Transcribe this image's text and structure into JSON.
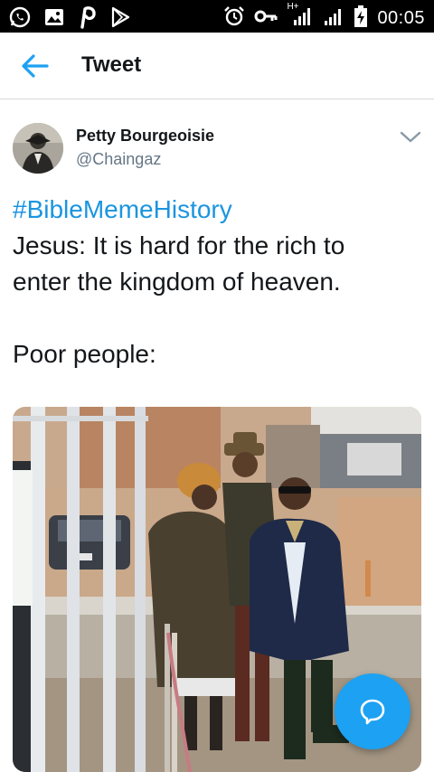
{
  "status_bar": {
    "time": "00:05",
    "network_label": "H+",
    "icons": [
      "whatsapp-icon",
      "gallery-icon",
      "pinterest-icon",
      "play-store-icon",
      "alarm-icon",
      "vpn-key-icon",
      "signal-icon",
      "signal-icon-2",
      "battery-charging-icon"
    ]
  },
  "app_bar": {
    "title": "Tweet",
    "back_icon": "arrow-left-icon"
  },
  "tweet": {
    "display_name": "Petty Bourgeoisie",
    "handle": "@Chaingaz",
    "hashtag": "#BibleMemeHistory",
    "lines": [
      "Jesus: It is hard for the rich to",
      "enter the kingdom of heaven."
    ],
    "line_after_break": "Poor people:",
    "media": "photo"
  },
  "fab": {
    "icon": "reply-bubble-icon"
  },
  "colors": {
    "accent": "#1da1f2",
    "hashtag": "#1b95e0",
    "text": "#14171a",
    "secondary_text": "#657786"
  }
}
